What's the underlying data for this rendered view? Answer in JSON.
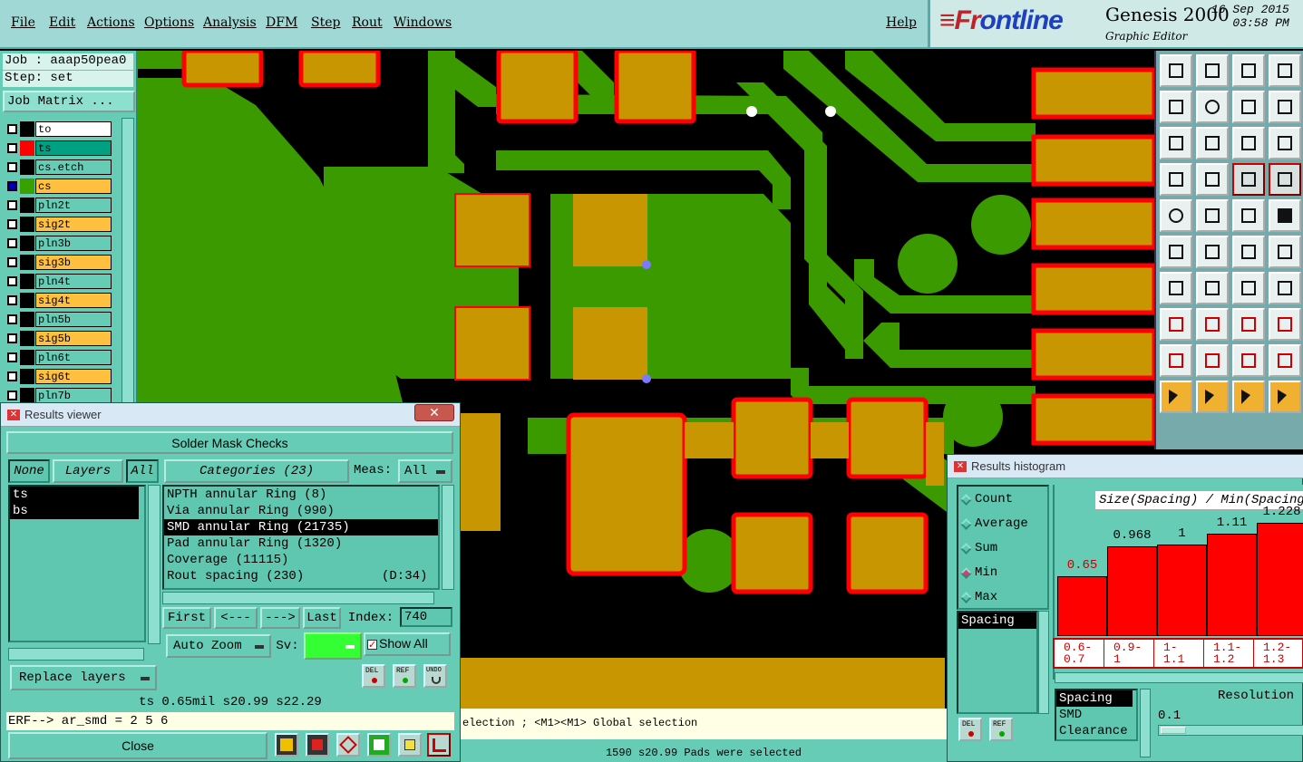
{
  "menu": [
    "File",
    "Edit",
    "Actions",
    "Options",
    "Analysis",
    "DFM",
    "Step",
    "Rout",
    "Windows"
  ],
  "help": "Help",
  "brand": {
    "logo_a": "≡Fr",
    "logo_b": "ontline",
    "product": "Genesis 2000",
    "subtitle": "Graphic Editor",
    "date": "16 Sep 2015",
    "time": "03:58 PM"
  },
  "job": {
    "job_line": "Job : aaap50pea0",
    "step_line": "Step: set",
    "matrix_button": "Job Matrix ..."
  },
  "layers": [
    {
      "name": "to",
      "color": "#000000",
      "bg": "#ffffff"
    },
    {
      "name": "ts",
      "color": "#ff0000",
      "bg": "#00a082"
    },
    {
      "name": "cs.etch",
      "color": "#000000",
      "bg": "#67ccb6"
    },
    {
      "name": "cs",
      "color": "#3aa000",
      "bg": "#ffc040",
      "active": true
    },
    {
      "name": "pln2t",
      "color": "#000000",
      "bg": "#67ccb6"
    },
    {
      "name": "sig2t",
      "color": "#000000",
      "bg": "#ffc040"
    },
    {
      "name": "pln3b",
      "color": "#000000",
      "bg": "#67ccb6"
    },
    {
      "name": "sig3b",
      "color": "#000000",
      "bg": "#ffc040"
    },
    {
      "name": "pln4t",
      "color": "#000000",
      "bg": "#67ccb6"
    },
    {
      "name": "sig4t",
      "color": "#000000",
      "bg": "#ffc040"
    },
    {
      "name": "pln5b",
      "color": "#000000",
      "bg": "#67ccb6"
    },
    {
      "name": "sig5b",
      "color": "#000000",
      "bg": "#ffc040"
    },
    {
      "name": "pln6t",
      "color": "#000000",
      "bg": "#67ccb6"
    },
    {
      "name": "sig6t",
      "color": "#000000",
      "bg": "#ffc040"
    },
    {
      "name": "pln7b",
      "color": "#000000",
      "bg": "#67ccb6"
    }
  ],
  "results_viewer": {
    "title": "Results viewer",
    "heading": "Solder Mask Checks",
    "none_btn": "None",
    "layers_btn": "Layers",
    "all_btn": "All",
    "categories_btn": "Categories (23)",
    "meas_label": "Meas:",
    "meas_value": "All",
    "layer_items": [
      "ts",
      "bs"
    ],
    "categories": [
      {
        "text": "NPTH annular Ring (8)",
        "sel": false
      },
      {
        "text": "Via annular Ring (990)",
        "sel": false
      },
      {
        "text": "SMD annular Ring (21735)",
        "sel": true
      },
      {
        "text": "Pad annular Ring (1320)",
        "sel": false
      },
      {
        "text": "Coverage (11115)",
        "sel": false
      },
      {
        "text": "Rout spacing (230)",
        "sel": false,
        "extra": "(D:34)"
      }
    ],
    "nav": {
      "first": "First",
      "prev": "<---",
      "next": "--->",
      "last": "Last",
      "index_label": "Index:",
      "index_value": "740"
    },
    "auto_zoom": "Auto Zoom",
    "sv_label": "Sv:",
    "show_all": "Show All",
    "replace_layers": "Replace layers",
    "del": "DEL",
    "ref": "REF",
    "undo": "UNDO",
    "info": "ts 0.65mil    s20.99    s22.29",
    "erf": "ERF--> ar_smd = 2 5 6",
    "close": "Close"
  },
  "histogram": {
    "title": "Results histogram",
    "radios": [
      {
        "label": "Count",
        "on": false
      },
      {
        "label": "Average",
        "on": false
      },
      {
        "label": "Sum",
        "on": false
      },
      {
        "label": "Min",
        "on": true
      },
      {
        "label": "Max",
        "on": false
      }
    ],
    "spacing_item": "Spacing",
    "header": "Size(Spacing) / Min(Spacing)",
    "bars": [
      {
        "value": "0.65",
        "range": "0.6-\n0.7",
        "level": 0.53,
        "red": true
      },
      {
        "value": "0.968",
        "range": "0.9-\n1",
        "level": 0.79
      },
      {
        "value": "1",
        "range": "1-\n1.1",
        "level": 0.81
      },
      {
        "value": "1.11",
        "range": "1.1-\n1.2",
        "level": 0.9
      },
      {
        "value": "1.228",
        "range": "1.2-\n1.3",
        "level": 1.0
      }
    ],
    "list": [
      {
        "text": "Spacing",
        "sel": true
      },
      {
        "text": "SMD",
        "sel": false
      },
      {
        "text": "Clearance",
        "sel": false
      }
    ],
    "resolution_label": "Resolution",
    "resolution_value": "0.1",
    "del": "DEL",
    "ref": "REF"
  },
  "status": {
    "line1": "election ; <M1><M1> Global selection",
    "line2": "1590 s20.99 Pads were selected"
  },
  "colors": {
    "copper": "#3a9a00",
    "pad": "#c89600",
    "pad_outline": "#ff0000",
    "panel": "#67ccb6"
  }
}
